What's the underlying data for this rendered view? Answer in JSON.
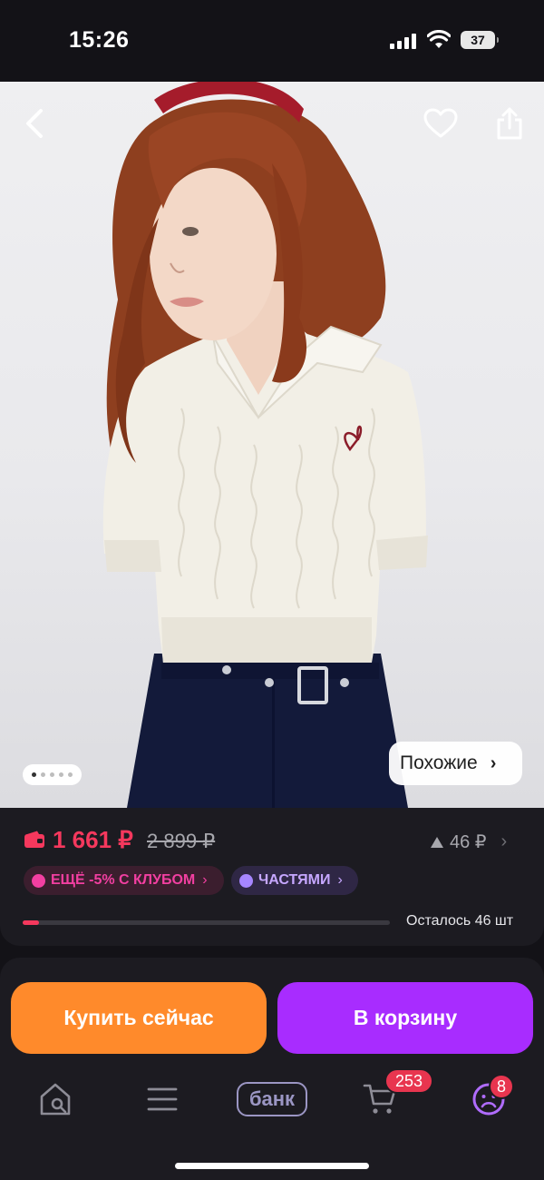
{
  "status_bar": {
    "time": "15:26",
    "battery": "37"
  },
  "product": {
    "price_now": "1 661 ₽",
    "price_old": "2 899 ₽",
    "price_change": "46 ₽",
    "club_chip": "ЕЩЁ -5% С КЛУБОМ",
    "installments_chip": "ЧАСТЯМИ",
    "stock_text": "Осталось 46 шт",
    "stock_fraction": 0.045,
    "gallery_pages": 5,
    "gallery_current": 1
  },
  "hero": {
    "similar_label": "Похожие"
  },
  "actions": {
    "buy_now": "Купить сейчас",
    "add_to_cart": "В корзину"
  },
  "tabbar": {
    "bank_label": "банк",
    "cart_count": "253",
    "profile_count": "8"
  },
  "colors": {
    "accent_price": "#f5385d",
    "buy_button": "#ff8a2b",
    "cart_button": "#a82cff",
    "club": "#f23fa1",
    "installments": "#a686ff"
  }
}
